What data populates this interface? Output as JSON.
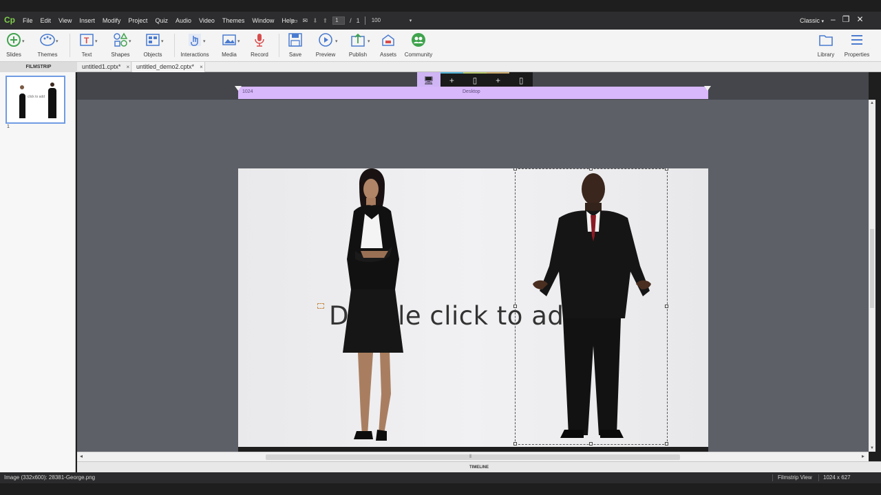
{
  "menubar": {
    "logo": "Cp",
    "items": [
      "File",
      "Edit",
      "View",
      "Insert",
      "Modify",
      "Project",
      "Quiz",
      "Audio",
      "Video",
      "Themes",
      "Window",
      "Help"
    ],
    "current_slide": "1",
    "slide_sep": "/",
    "total_slides": "1",
    "zoom": "100",
    "mode": "Classic"
  },
  "toolbar": {
    "slides": "Slides",
    "themes": "Themes",
    "text": "Text",
    "shapes": "Shapes",
    "objects": "Objects",
    "interactions": "Interactions",
    "media": "Media",
    "record": "Record",
    "save": "Save",
    "preview": "Preview",
    "publish": "Publish",
    "assets": "Assets",
    "community": "Community",
    "library": "Library",
    "properties": "Properties"
  },
  "tabs": {
    "filmstrip": "FILMSTRIP",
    "docs": [
      {
        "label": "untitled1.cptx*",
        "close": "×"
      },
      {
        "label": "untitled_demo2.cptx*",
        "close": "×"
      }
    ]
  },
  "filmstrip": {
    "thumb_text": "click to add",
    "slide_number": "1"
  },
  "stage": {
    "breakpoint_width": "1024",
    "breakpoint_name": "Desktop",
    "placeholder_text": "Double click to add"
  },
  "timeline": {
    "label": "TIMELINE"
  },
  "status": {
    "info": "Image (332x600): 28381-George.png",
    "view": "Filmstrip View",
    "size": "1024 x 627"
  },
  "colors": {
    "accent_purple": "#d8b7fb",
    "selection_blue": "#6f9be4",
    "logo_green": "#7fd04b"
  }
}
